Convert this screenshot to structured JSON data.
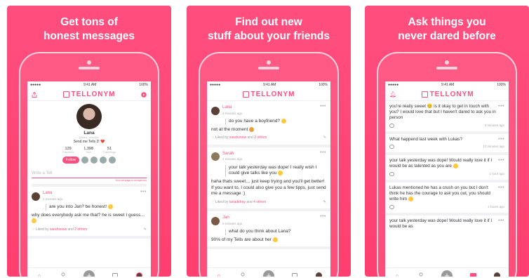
{
  "panels": [
    {
      "headline": [
        "Get tons of",
        "honest messages"
      ],
      "status": {
        "carrier": "●●●●●",
        "time": "9:41 AM",
        "battery": "100%"
      },
      "app_title": "TELLONYM",
      "profile": {
        "name": "Lana",
        "handle": "@lana_tellonym",
        "bio": "Send me Tells 2! ❤️",
        "stats": [
          {
            "value": "129",
            "label": "Followers"
          },
          {
            "value": "1,398",
            "label": "Tells"
          },
          {
            "value": "51",
            "label": "Followings"
          }
        ],
        "follow_label": "Follow"
      },
      "composer": {
        "placeholder": "Write a Tell",
        "hint": "Your message is anonymous"
      },
      "message": {
        "name": "Lana",
        "time": "2 minutes ago",
        "question": "are you into Jan? be honest!",
        "answer": "why does everybody ask me that? he is sweet I guess…",
        "liked_prefix": "Liked by",
        "liked_user": "sarahsnow",
        "liked_and": "and",
        "liked_others": "2 others"
      }
    },
    {
      "headline": [
        "Find out new",
        "stuff about your friends"
      ],
      "status": {
        "carrier": "●●●●●",
        "time": "9:41 AM",
        "battery": "100%"
      },
      "app_title": "TELLONYM",
      "messages": [
        {
          "name": "Lana",
          "time": "3 minutes ago",
          "question": "do you have a boyfriend?",
          "answer": "not at the moment",
          "liked_prefix": "Liked by",
          "liked_user": "sarahsnow",
          "liked_and": "and",
          "liked_others": "2 others"
        },
        {
          "name": "Sarah",
          "time": "4 minutes ago",
          "question": "your talk yesterday was dope! I really wish I could give talks like you",
          "answer": "haha thats sweet… just keep trying and you'll get better! If you want to, I could also give you a few tipps, just send me a message :)",
          "liked_prefix": "Liked by",
          "liked_user": "lanadelray",
          "liked_and": "and",
          "liked_others": "4 others"
        },
        {
          "name": "Jan",
          "time": "5 minutes ago",
          "question": "what do you think about Lana?",
          "answer": "90% of my Tells are about her"
        }
      ]
    },
    {
      "headline": [
        "Ask things you",
        "never dared before"
      ],
      "status": {
        "carrier": "●●●●●",
        "time": "9:41 AM",
        "battery": "100%"
      },
      "app_title": "TELLONYM",
      "tells": [
        {
          "text": "you're really sweet 😊 is it okay to get in touch with you? I would love that but I haven't dared to ask you in person",
          "time": "3 minutes ago"
        },
        {
          "text": "What happend last week with Lukas?",
          "time": "12 minutes ago"
        },
        {
          "text": "your talk yesterday was dope! Would really love it if I would be as talented as you are",
          "time": "1 hour ago"
        },
        {
          "text": "Lukas mentioned he has a crush on you but I don't think he has the courage to ask you out, you should write him",
          "time": "2 hours ago"
        },
        {
          "text": "your talk yesterday was dope! Would really love it if I would be as",
          "time": ""
        }
      ]
    }
  ],
  "colors": {
    "accent": "#ff4f7f",
    "panel_bg": "#fe4474"
  },
  "icons": [
    "share-icon",
    "send-icon",
    "home-icon",
    "search-icon",
    "plus-icon",
    "inbox-icon",
    "profile-icon",
    "bell-icon",
    "comment-icon",
    "edit-icon",
    "heart-icon"
  ]
}
